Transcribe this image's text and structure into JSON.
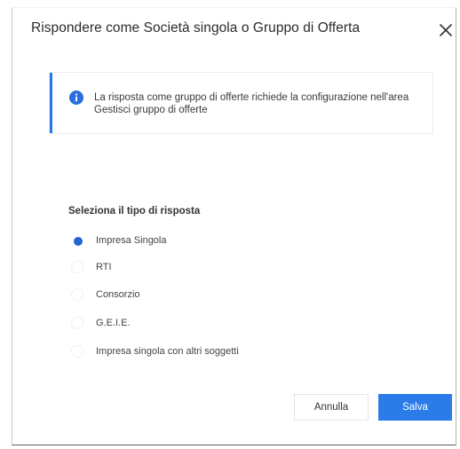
{
  "dialog": {
    "title": "Rispondere come Società singola o Gruppo di Offerta",
    "close_icon": "close-icon"
  },
  "info": {
    "icon": "info-icon",
    "message": "La risposta come gruppo di offerte richiede la configurazione nell'area Gestisci gruppo di offerte",
    "accent_color": "#2a78e4"
  },
  "response_type": {
    "label": "Seleziona il tipo di risposta",
    "selected": "Impresa Singola",
    "options": [
      {
        "label": "Impresa Singola",
        "checked": true
      },
      {
        "label": "RTI",
        "checked": false
      },
      {
        "label": "Consorzio",
        "checked": false
      },
      {
        "label": "G.E.I.E.",
        "checked": false
      },
      {
        "label": "Impresa singola con altri soggetti",
        "checked": false
      }
    ]
  },
  "actions": {
    "cancel_label": "Annulla",
    "save_label": "Salva",
    "primary_color": "#2b7ce9"
  }
}
